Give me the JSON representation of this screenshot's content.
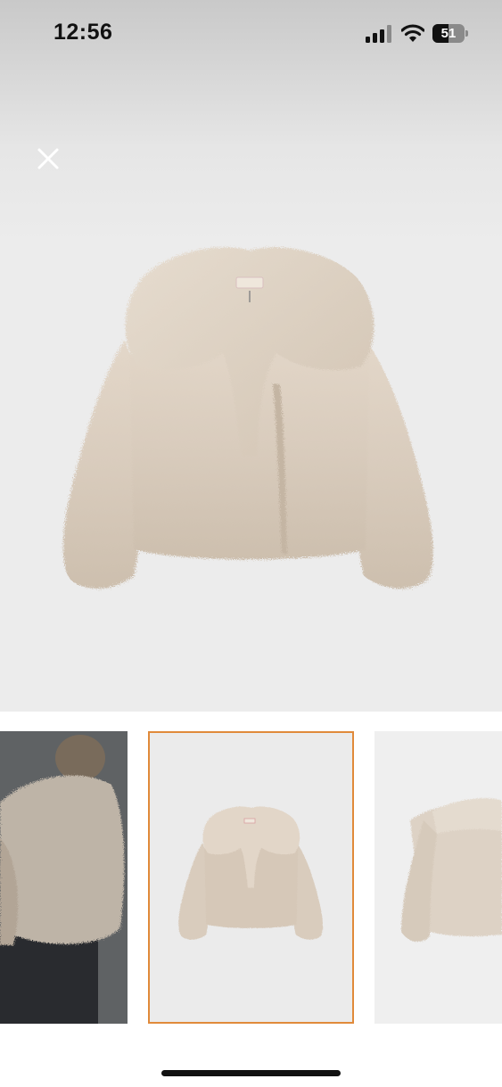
{
  "status_bar": {
    "time": "12:56",
    "battery_text": "51",
    "battery_level": 0.51,
    "signal_icon": "cellular-signal-icon",
    "wifi_icon": "wifi-icon"
  },
  "viewer": {
    "close_icon": "close-icon",
    "selected_thumbnail": 1
  },
  "colors": {
    "background": "#ececec",
    "fur": "#d9ccbd",
    "selection_border": "#e08a3a"
  },
  "thumbnails": [
    {
      "icon": "model-wearing-jacket-image"
    },
    {
      "icon": "jacket-front-image"
    },
    {
      "icon": "jacket-back-image"
    }
  ]
}
